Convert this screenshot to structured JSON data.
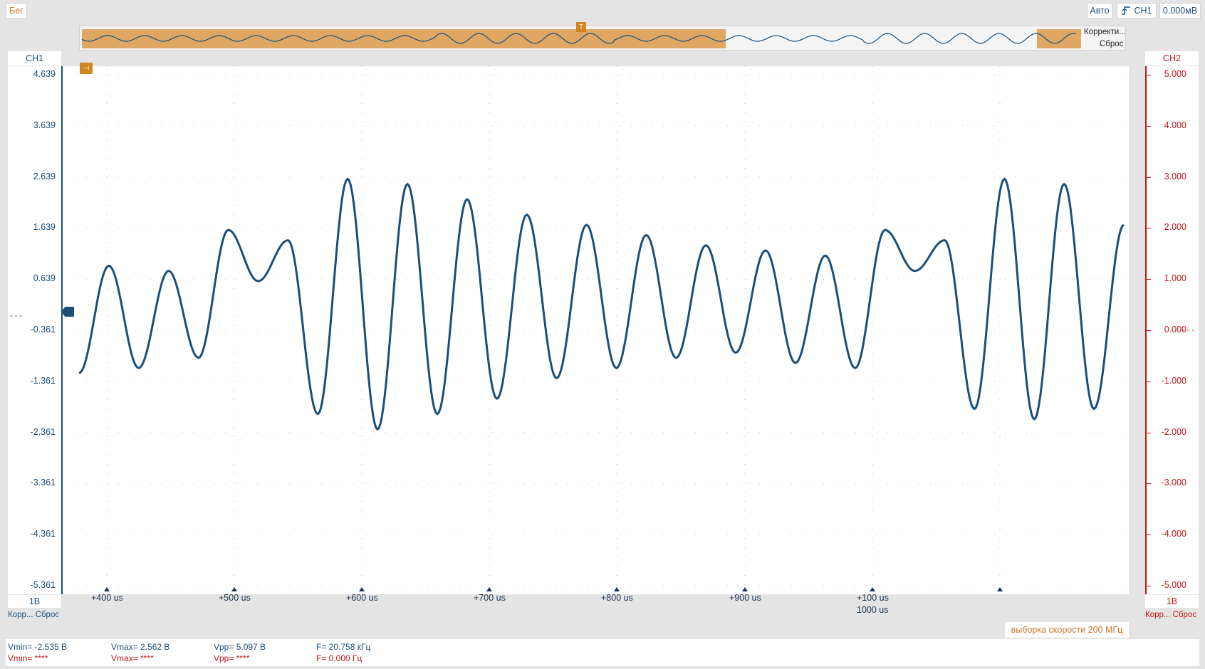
{
  "toolbar": {
    "status": "Бег",
    "mode_button": "Авто",
    "trigger_source": "CH1",
    "trigger_level": "0.000мВ"
  },
  "overview": {
    "trigger_marker": "T",
    "correct_label": "Корректи...",
    "reset_label": "Сброс"
  },
  "ch1": {
    "header": "CH1",
    "scale_labels": [
      "4.639",
      "3.639",
      "2.639",
      "1.639",
      "0.639",
      "-0.361",
      "-1.361",
      "-2.361",
      "-3.361",
      "-4.361",
      "-5.361"
    ],
    "volts_per_div": "1В",
    "bottom_labels": "Корр... Сброс",
    "color": "#1a4f7a"
  },
  "ch2": {
    "header": "CH2",
    "scale_labels": [
      "5.000",
      "4.000",
      "3.000",
      "2.000",
      "1.000",
      "0.000",
      "-1.000",
      "-2.000",
      "-3.000",
      "-4.000",
      "-5.000"
    ],
    "volts_per_div": "1В",
    "bottom_labels": "Корр... Сброс",
    "color": "#c0161c"
  },
  "time_axis": {
    "ticks": [
      "+400 us",
      "+500 us",
      "+600 us",
      "+700 us",
      "+800 us",
      "+900 us",
      "+100 us"
    ],
    "center_label": "1000 us"
  },
  "sample_rate": "выборка скорости 200 МГц",
  "measurements": {
    "ch1": {
      "vmin": "Vmin= -2.535 В",
      "vmax": "Vmax= 2.562 В",
      "vpp": "Vpp= 5.097 В",
      "freq": "F= 20.758 кГц"
    },
    "ch2": {
      "vmin": "Vmin= ****",
      "vmax": "Vmax= ****",
      "vpp": "Vpp= ****",
      "freq": "F= 0.000 Гц"
    }
  },
  "waveform": {
    "extrema_volts": [
      -1.2,
      0.9,
      -1.1,
      0.8,
      -0.9,
      1.6,
      0.6,
      1.4,
      -2.0,
      2.6,
      -2.3,
      2.5,
      -2.0,
      2.2,
      -1.7,
      1.9,
      -1.3,
      1.7,
      -1.1,
      1.5,
      -0.9,
      1.3,
      -0.8,
      1.2,
      -1.0,
      1.1,
      -1.1,
      1.6,
      0.8,
      1.4,
      -1.9,
      2.6,
      -2.1,
      2.5,
      -1.9,
      1.7
    ]
  }
}
